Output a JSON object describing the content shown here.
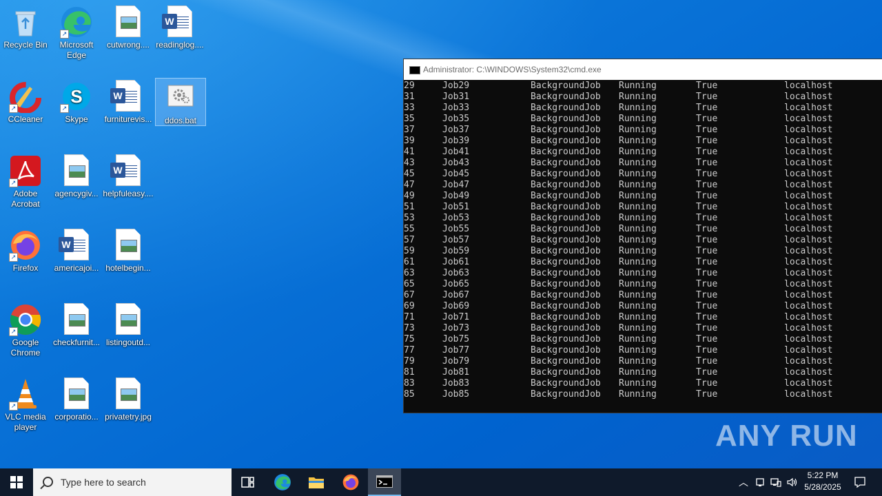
{
  "desktop": {
    "icons": [
      {
        "label": "Recycle Bin"
      },
      {
        "label": "Microsoft Edge"
      },
      {
        "label": "cutwrong...."
      },
      {
        "label": "readinglog...."
      },
      {
        "label": "CCleaner"
      },
      {
        "label": "Skype"
      },
      {
        "label": "furniturevis..."
      },
      {
        "label": "ddos.bat"
      },
      {
        "label": "Adobe Acrobat"
      },
      {
        "label": "agencygiv..."
      },
      {
        "label": "helpfuleasy...."
      },
      {
        "label": "Firefox"
      },
      {
        "label": "americajoi..."
      },
      {
        "label": "hotelbegin..."
      },
      {
        "label": "Google Chrome"
      },
      {
        "label": "checkfurnit..."
      },
      {
        "label": "listingoutd..."
      },
      {
        "label": "VLC media player"
      },
      {
        "label": "corporatio..."
      },
      {
        "label": "privatetry.jpg"
      }
    ]
  },
  "cmd": {
    "title": "Administrator: C:\\WINDOWS\\System32\\cmd.exe",
    "rows": [
      {
        "id": "29",
        "name": "Job29",
        "type": "BackgroundJob",
        "state": "Running",
        "more": "True",
        "location": "localhost"
      },
      {
        "id": "31",
        "name": "Job31",
        "type": "BackgroundJob",
        "state": "Running",
        "more": "True",
        "location": "localhost"
      },
      {
        "id": "33",
        "name": "Job33",
        "type": "BackgroundJob",
        "state": "Running",
        "more": "True",
        "location": "localhost"
      },
      {
        "id": "35",
        "name": "Job35",
        "type": "BackgroundJob",
        "state": "Running",
        "more": "True",
        "location": "localhost"
      },
      {
        "id": "37",
        "name": "Job37",
        "type": "BackgroundJob",
        "state": "Running",
        "more": "True",
        "location": "localhost"
      },
      {
        "id": "39",
        "name": "Job39",
        "type": "BackgroundJob",
        "state": "Running",
        "more": "True",
        "location": "localhost"
      },
      {
        "id": "41",
        "name": "Job41",
        "type": "BackgroundJob",
        "state": "Running",
        "more": "True",
        "location": "localhost"
      },
      {
        "id": "43",
        "name": "Job43",
        "type": "BackgroundJob",
        "state": "Running",
        "more": "True",
        "location": "localhost"
      },
      {
        "id": "45",
        "name": "Job45",
        "type": "BackgroundJob",
        "state": "Running",
        "more": "True",
        "location": "localhost"
      },
      {
        "id": "47",
        "name": "Job47",
        "type": "BackgroundJob",
        "state": "Running",
        "more": "True",
        "location": "localhost"
      },
      {
        "id": "49",
        "name": "Job49",
        "type": "BackgroundJob",
        "state": "Running",
        "more": "True",
        "location": "localhost"
      },
      {
        "id": "51",
        "name": "Job51",
        "type": "BackgroundJob",
        "state": "Running",
        "more": "True",
        "location": "localhost"
      },
      {
        "id": "53",
        "name": "Job53",
        "type": "BackgroundJob",
        "state": "Running",
        "more": "True",
        "location": "localhost"
      },
      {
        "id": "55",
        "name": "Job55",
        "type": "BackgroundJob",
        "state": "Running",
        "more": "True",
        "location": "localhost"
      },
      {
        "id": "57",
        "name": "Job57",
        "type": "BackgroundJob",
        "state": "Running",
        "more": "True",
        "location": "localhost"
      },
      {
        "id": "59",
        "name": "Job59",
        "type": "BackgroundJob",
        "state": "Running",
        "more": "True",
        "location": "localhost"
      },
      {
        "id": "61",
        "name": "Job61",
        "type": "BackgroundJob",
        "state": "Running",
        "more": "True",
        "location": "localhost"
      },
      {
        "id": "63",
        "name": "Job63",
        "type": "BackgroundJob",
        "state": "Running",
        "more": "True",
        "location": "localhost"
      },
      {
        "id": "65",
        "name": "Job65",
        "type": "BackgroundJob",
        "state": "Running",
        "more": "True",
        "location": "localhost"
      },
      {
        "id": "67",
        "name": "Job67",
        "type": "BackgroundJob",
        "state": "Running",
        "more": "True",
        "location": "localhost"
      },
      {
        "id": "69",
        "name": "Job69",
        "type": "BackgroundJob",
        "state": "Running",
        "more": "True",
        "location": "localhost"
      },
      {
        "id": "71",
        "name": "Job71",
        "type": "BackgroundJob",
        "state": "Running",
        "more": "True",
        "location": "localhost"
      },
      {
        "id": "73",
        "name": "Job73",
        "type": "BackgroundJob",
        "state": "Running",
        "more": "True",
        "location": "localhost"
      },
      {
        "id": "75",
        "name": "Job75",
        "type": "BackgroundJob",
        "state": "Running",
        "more": "True",
        "location": "localhost"
      },
      {
        "id": "77",
        "name": "Job77",
        "type": "BackgroundJob",
        "state": "Running",
        "more": "True",
        "location": "localhost"
      },
      {
        "id": "79",
        "name": "Job79",
        "type": "BackgroundJob",
        "state": "Running",
        "more": "True",
        "location": "localhost"
      },
      {
        "id": "81",
        "name": "Job81",
        "type": "BackgroundJob",
        "state": "Running",
        "more": "True",
        "location": "localhost"
      },
      {
        "id": "83",
        "name": "Job83",
        "type": "BackgroundJob",
        "state": "Running",
        "more": "True",
        "location": "localhost"
      },
      {
        "id": "85",
        "name": "Job85",
        "type": "BackgroundJob",
        "state": "Running",
        "more": "True",
        "location": "localhost"
      }
    ]
  },
  "watermark": {
    "text": "ANY RUN"
  },
  "taskbar": {
    "search_placeholder": "Type here to search",
    "clock_time": "5:22 PM",
    "clock_date": "5/28/2025"
  }
}
